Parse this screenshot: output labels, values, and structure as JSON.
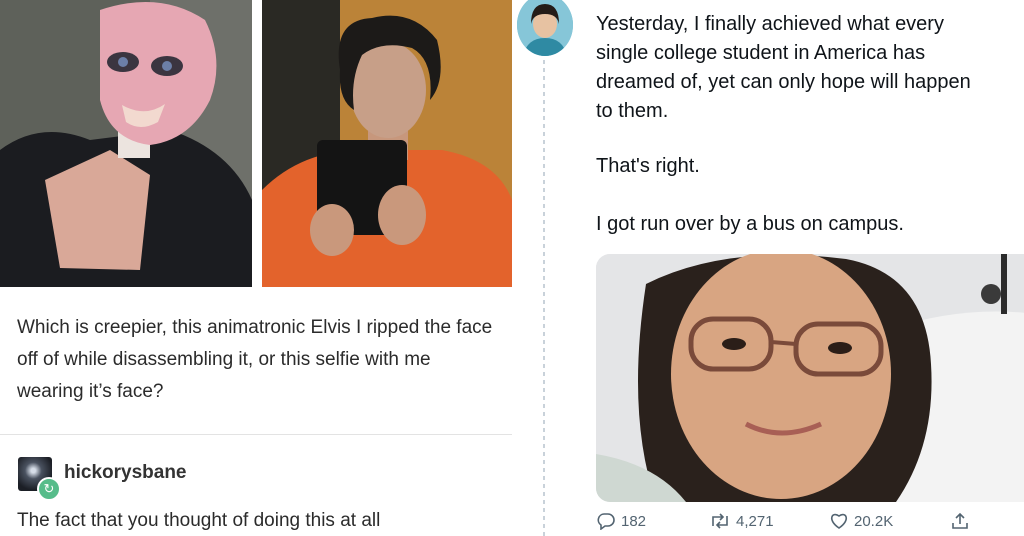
{
  "tumblr": {
    "caption": "Which is creepier, this animatronic Elvis I ripped the face off of while disassembling it, or this selfie with me wearing it’s face?",
    "reply_username": "hickorysbane",
    "reply_text": "The fact that you thought of doing this at all",
    "reblog_icon": "reblog-icon"
  },
  "tweet": {
    "line1": "Yesterday, I finally achieved what every",
    "line2": "single college student in America has",
    "line3": "dreamed of, yet can only hope will happen",
    "line4": "to them.",
    "para2": "That's right.",
    "para3": "I got run over by a bus on campus.",
    "replies": "182",
    "retweets": "4,271",
    "likes": "20.2K",
    "icons": [
      "reply-icon",
      "retweet-icon",
      "like-icon",
      "share-icon"
    ]
  }
}
